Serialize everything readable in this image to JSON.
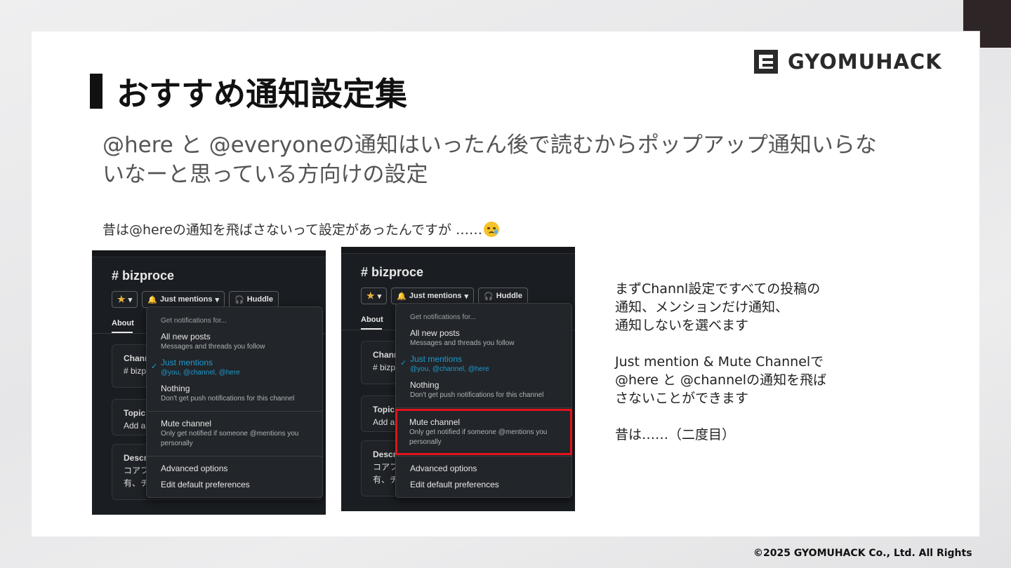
{
  "brand": {
    "logo_text": "GYOMUHACK"
  },
  "slide": {
    "title": "おすすめ通知設定集",
    "subtitle": "@here と @everyoneの通知はいったん後で読むからポップアップ通知いらないなーと思っている方向け の設定",
    "note": "昔は@hereの通知を飛ばさないって設定があったんですが ……"
  },
  "screenshot_a": {
    "channel": "# bizproce",
    "star_button": "▾",
    "notify_button": "Just mentions",
    "huddle_button": "Huddle",
    "about_tab": "About",
    "cards": [
      {
        "title": "Chann",
        "body": "# bizp"
      },
      {
        "title": "Topic",
        "body": "Add a"
      },
      {
        "title": "Descr",
        "body": "コアフ\n有、チ"
      }
    ],
    "menu": {
      "header": "Get notifications for...",
      "items": [
        {
          "label": "All new posts",
          "desc": "Messages and threads you follow"
        },
        {
          "label": "Just mentions",
          "desc": "@you, @channel, @here"
        },
        {
          "label": "Nothing",
          "desc": "Don't get push notifications for this channel"
        },
        {
          "label": "Mute channel",
          "desc": "Only get notified if someone @mentions you personally"
        },
        {
          "label": "Advanced options"
        },
        {
          "label": "Edit default preferences"
        }
      ]
    }
  },
  "screenshot_b": {
    "channel": "# bizproce",
    "notify_button": "Just mentions",
    "huddle_button": "Huddle",
    "about_tab": "About",
    "cards": [
      {
        "title": "Chann",
        "body": "# bizp"
      },
      {
        "title": "Topic",
        "body": "Add a"
      },
      {
        "title": "Descr",
        "body": "コアフ\n有、チ"
      }
    ],
    "menu": {
      "header": "Get notifications for...",
      "items": [
        {
          "label": "All new posts",
          "desc": "Messages and threads you follow"
        },
        {
          "label": "Just mentions",
          "desc": "@you, @channel, @here"
        },
        {
          "label": "Nothing",
          "desc": "Don't get push notifications for this channel"
        },
        {
          "label": "Mute channel",
          "desc": "Only get notified if someone @mentions you personally"
        },
        {
          "label": "Advanced options"
        },
        {
          "label": "Edit default preferences"
        }
      ]
    },
    "highlight_color": "#e0141b"
  },
  "explanation": {
    "p1": "まずChannl設定ですべての投稿の\n通知、メンションだけ通知、\n通知しないを選べます",
    "p2": "Just mention & Mute Channelで\n@here と @channelの通知を飛ば\nさないことができます",
    "p3": "昔は……（二度目）"
  },
  "footer": {
    "copyright": "©2025 GYOMUHACK Co., Ltd. All Rights"
  },
  "colors": {
    "slack_bg": "#1a1d21",
    "slack_selected": "#1d9bd1",
    "title_bar": "#111111"
  }
}
